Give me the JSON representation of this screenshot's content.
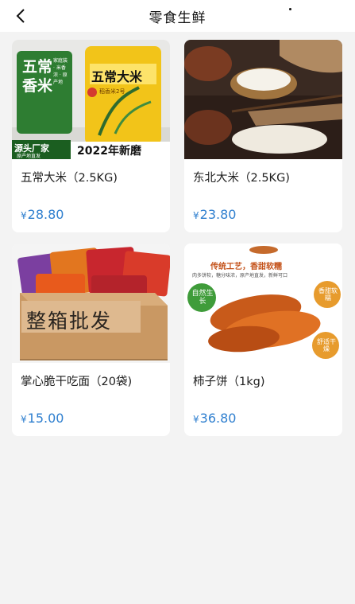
{
  "header": {
    "title": "零食生鲜"
  },
  "products": [
    {
      "name": "五常大米（2.5KG)",
      "currency": "¥",
      "price": "28.80",
      "image_text": {
        "side_label": "五常香米",
        "side_tags": "家庭装 · 米香浓 · 原产地",
        "bag_title": "五常大米",
        "bag_sub": "稻香米2号",
        "badge": "源头厂家",
        "badge_sub": "原产地直发",
        "year_banner": "2022年新磨"
      }
    },
    {
      "name": "东北大米（2.5KG)",
      "currency": "¥",
      "price": "23.80"
    },
    {
      "name": "掌心脆干吃面（20袋)",
      "currency": "¥",
      "price": "15.00",
      "image_text": {
        "box_label": "整箱批发"
      }
    },
    {
      "name": "柿子饼（1kg)",
      "currency": "¥",
      "price": "36.80",
      "image_text": {
        "top_banner": "传统工艺，香甜软糯",
        "sub_banner": "肉多饼软，糖分味浓，原产地直发，新鲜可口",
        "badge_left": "自然生长",
        "badge_right_top": "香甜软糯",
        "badge_right_bottom": "舒适干燥"
      }
    }
  ]
}
